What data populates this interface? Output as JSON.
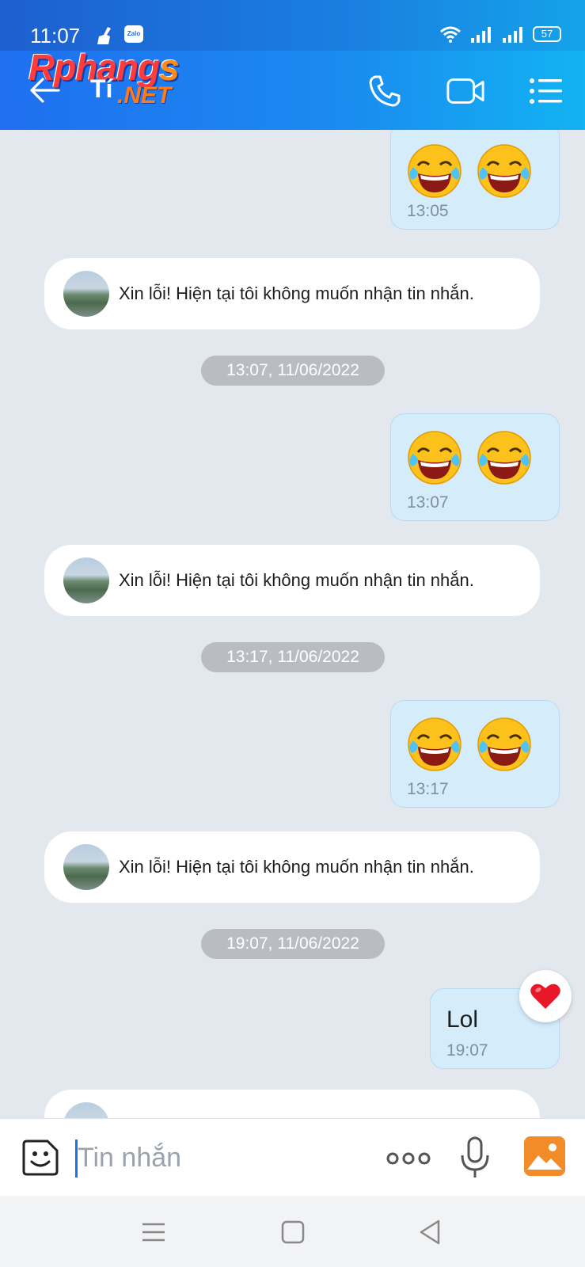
{
  "status": {
    "time": "11:07",
    "zalo_badge": "Zalo",
    "battery": "57"
  },
  "brand": {
    "line1_main": "Rphang",
    "line1_s": "s",
    "ti": "Tí",
    "net": ".NET"
  },
  "appbar": {
    "icons": [
      "back-arrow-icon",
      "phone-icon",
      "video-call-icon",
      "menu-list-icon"
    ]
  },
  "messages": {
    "m1": {
      "time": "13:05"
    },
    "auto1": {
      "text": "Xin lỗi! Hiện tại tôi không muốn nhận tin nhắn."
    },
    "date1": "13:07, 11/06/2022",
    "m2": {
      "time": "13:07"
    },
    "auto2": {
      "text": "Xin lỗi! Hiện tại tôi không muốn nhận tin nhắn."
    },
    "date2": "13:17, 11/06/2022",
    "m3": {
      "time": "13:17"
    },
    "auto3": {
      "text": "Xin lỗi! Hiện tại tôi không muốn nhận tin nhắn."
    },
    "date3": "19:07, 11/06/2022",
    "m4": {
      "text": "Lol",
      "time": "19:07",
      "reaction": "heart-icon"
    }
  },
  "input": {
    "placeholder": "Tin nhắn"
  },
  "colors": {
    "header_start": "#1f6ff0",
    "header_end": "#12b3f2",
    "bubble_out": "#d5ecfb",
    "chat_bg": "#e3e8ef"
  }
}
